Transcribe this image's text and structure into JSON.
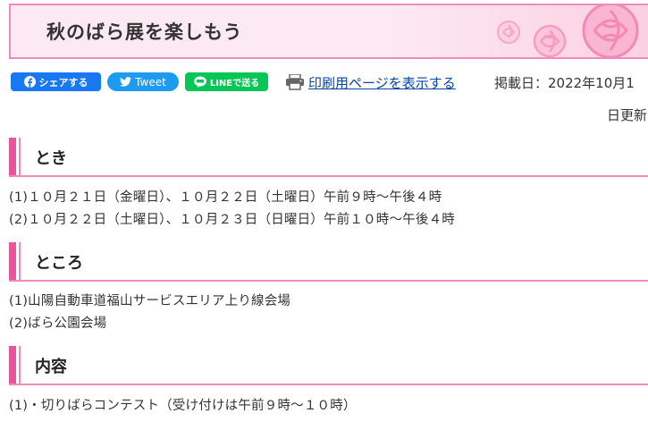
{
  "header": {
    "title": "秋のばら展を楽しもう"
  },
  "share": {
    "facebook_label": "シェアする",
    "twitter_label": "Tweet",
    "line_label": "LINEで送る"
  },
  "print": {
    "link_label": "印刷用ページを表示する"
  },
  "meta": {
    "published": "掲載日：2022年10月1",
    "updated": "日更新"
  },
  "sections": [
    {
      "heading": "とき",
      "lines": [
        "(1)１０月２１日（金曜日）、１０月２２日（土曜日）午前９時～午後４時",
        "(2)１０月２２日（土曜日）、１０月２３日（日曜日）午前１０時～午後４時"
      ]
    },
    {
      "heading": "ところ",
      "lines": [
        "(1)山陽自動車道福山サービスエリア上り線会場",
        "(2)ばら公園会場"
      ]
    },
    {
      "heading": "内容",
      "lines": [
        "(1)・切りばらコンテスト（受け付けは午前９時～１０時）"
      ]
    }
  ],
  "colors": {
    "accent_pink": "#e8559a",
    "border_pink": "#f08bbd",
    "banner_bg": "#fde9f1",
    "link": "#0645ad",
    "facebook": "#1877f2",
    "twitter": "#1d9bf0",
    "line": "#06c755"
  },
  "icons": {
    "facebook": "facebook-icon",
    "twitter": "twitter-bird-icon",
    "line": "line-chat-icon",
    "print": "printer-icon",
    "decoration": "rose-icon"
  }
}
